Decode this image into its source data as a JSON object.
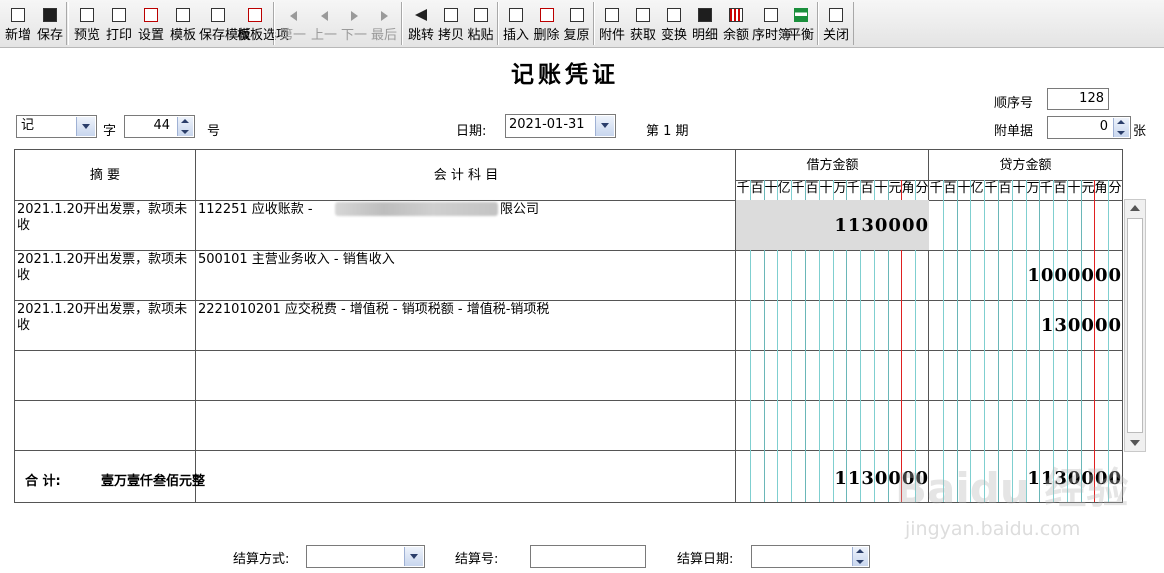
{
  "toolbar": {
    "buttons": [
      {
        "label": "新增",
        "icon": "new-document-icon"
      },
      {
        "label": "保存",
        "icon": "save-disk-icon"
      },
      {
        "label": "预览",
        "icon": "preview-icon"
      },
      {
        "label": "打印",
        "icon": "printer-icon"
      },
      {
        "label": "设置",
        "icon": "settings-page-icon"
      },
      {
        "label": "模板",
        "icon": "template-icon"
      },
      {
        "label": "保存模板",
        "icon": "save-template-icon"
      },
      {
        "label": "模板选项",
        "icon": "template-options-icon"
      },
      {
        "label": "第一",
        "icon": "first-record-icon"
      },
      {
        "label": "上一",
        "icon": "previous-record-icon"
      },
      {
        "label": "下一",
        "icon": "next-record-icon"
      },
      {
        "label": "最后",
        "icon": "last-record-icon"
      },
      {
        "label": "跳转",
        "icon": "goto-arrow-icon"
      },
      {
        "label": "拷贝",
        "icon": "copy-icon"
      },
      {
        "label": "粘贴",
        "icon": "paste-icon"
      },
      {
        "label": "插入",
        "icon": "insert-row-icon"
      },
      {
        "label": "删除",
        "icon": "delete-row-icon"
      },
      {
        "label": "复原",
        "icon": "restore-icon"
      },
      {
        "label": "附件",
        "icon": "attachment-icon"
      },
      {
        "label": "获取",
        "icon": "fetch-icon"
      },
      {
        "label": "变换",
        "icon": "transform-icon"
      },
      {
        "label": "明细",
        "icon": "binoculars-icon"
      },
      {
        "label": "余额",
        "icon": "balance-grid-icon"
      },
      {
        "label": "序时簿",
        "icon": "journal-icon"
      },
      {
        "label": "平衡",
        "icon": "balance-equals-icon"
      },
      {
        "label": "关闭",
        "icon": "close-door-icon"
      }
    ]
  },
  "voucher": {
    "title": "记账凭证",
    "seq_label": "顺序号",
    "seq_value": "128",
    "word_type": "记",
    "word_label": "字",
    "number_value": "44",
    "number_label": "号",
    "date_label": "日期:",
    "date_value": "2021-01-31",
    "period_text": "第 1 期",
    "attach_label": "附单据",
    "attach_value": "0",
    "attach_unit": "张"
  },
  "table": {
    "col_summary": "摘    要",
    "col_account": "会  计  科  目",
    "col_debit": "借方金额",
    "col_credit": "贷方金额",
    "digit_headers": [
      "千",
      "百",
      "十",
      "亿",
      "千",
      "百",
      "十",
      "万",
      "千",
      "百",
      "十",
      "元",
      "角",
      "分"
    ],
    "rows": [
      {
        "summary": "2021.1.20开出发票，款项未收",
        "account_prefix": "112251  应收账款 - ",
        "account_suffix": "限公司",
        "debit": "1130000",
        "credit": ""
      },
      {
        "summary": "2021.1.20开出发票，款项未收",
        "account_prefix": "500101  主营业务收入 - 销售收入",
        "account_suffix": "",
        "debit": "",
        "credit": "1000000"
      },
      {
        "summary": "2021.1.20开出发票，款项未收",
        "account_prefix": "2221010201  应交税费 - 增值税 - 销项税额 - 增值税-销项税",
        "account_suffix": "",
        "debit": "",
        "credit": "130000"
      },
      {
        "summary": "",
        "account_prefix": "",
        "account_suffix": "",
        "debit": "",
        "credit": ""
      },
      {
        "summary": "",
        "account_prefix": "",
        "account_suffix": "",
        "debit": "",
        "credit": ""
      }
    ],
    "total_label": "合  计:",
    "total_words": "壹万壹仟叁佰元整",
    "total_debit": "1130000",
    "total_credit": "1130000"
  },
  "footer": {
    "settle_method_label": "结算方式:",
    "settle_method_value": "",
    "settle_no_label": "结算号:",
    "settle_no_value": "",
    "settle_date_label": "结算日期:",
    "settle_date_value": ""
  },
  "watermark": {
    "text": "Baidu 经验",
    "url_text": "jingyan.baidu.com"
  },
  "colors": {
    "grid_teal": "#7fcfd0",
    "grid_red": "#e02020",
    "selected_cell": "#dcdcdc"
  }
}
